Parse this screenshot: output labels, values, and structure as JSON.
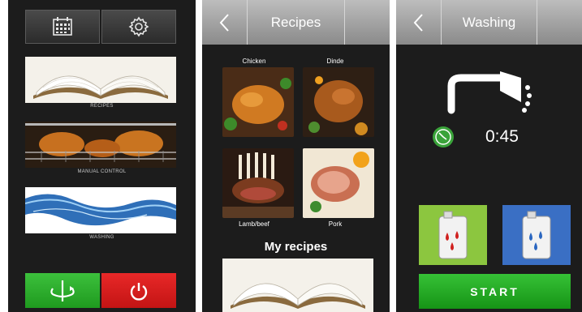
{
  "panel1": {
    "tiles": [
      {
        "label": "RECIPES"
      },
      {
        "label": "MANUAL CONTROL"
      },
      {
        "label": "WASHING"
      }
    ],
    "colors": {
      "rotate_button": "#2aa12a",
      "power_button": "#d91c1c"
    },
    "icons": {
      "calendar": "calendar-icon",
      "settings": "gear-icon",
      "rotate": "rotation-icon",
      "power": "power-icon"
    }
  },
  "panel2": {
    "title": "Recipes",
    "recipes": [
      "Chicken",
      "Dinde",
      "Lamb/beef",
      "Pork"
    ],
    "my_recipes": "My recipes"
  },
  "panel3": {
    "title": "Washing",
    "time": "0:45",
    "start_label": "START",
    "colors": {
      "red_jug_bg": "#8cc63f",
      "blue_jug_bg": "#3a6fc4",
      "start": "#22a822"
    }
  }
}
